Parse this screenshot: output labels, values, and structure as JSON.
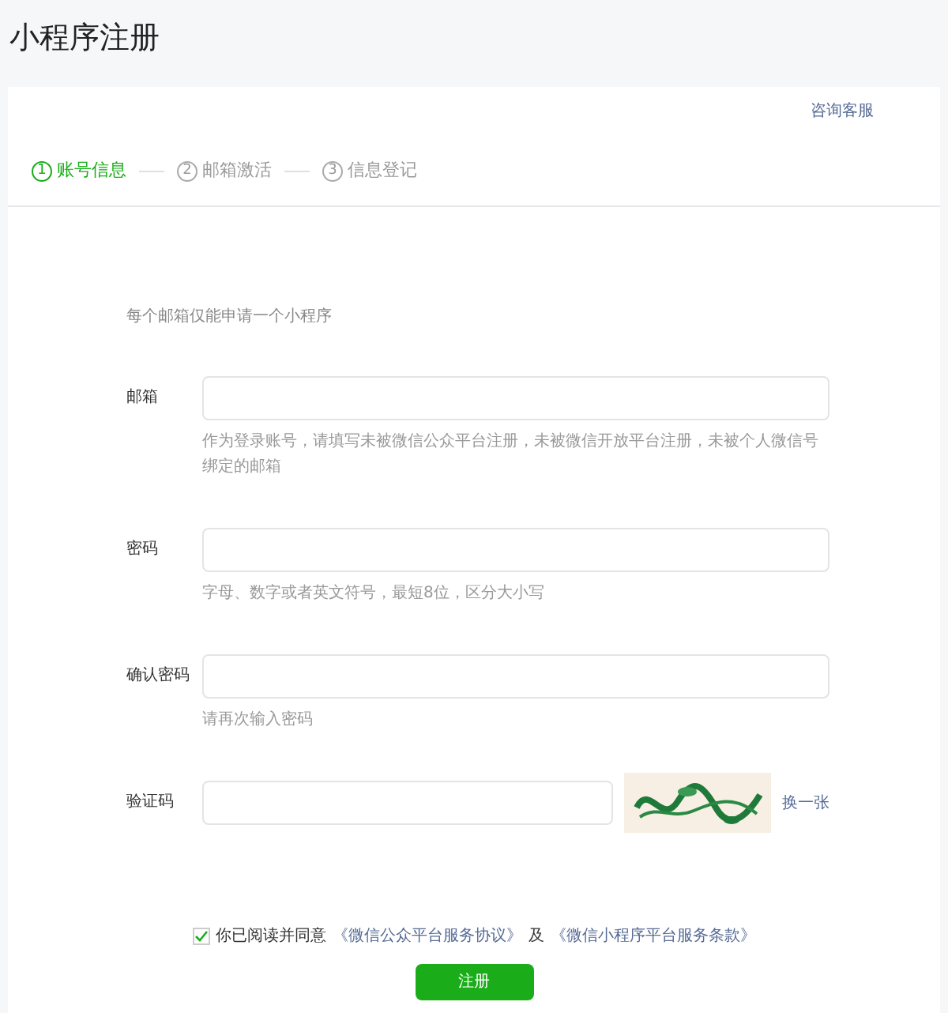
{
  "page_title": "小程序注册",
  "support_link": "咨询客服",
  "steps": [
    {
      "number": "1",
      "label": "账号信息",
      "selected": true
    },
    {
      "number": "2",
      "label": "邮箱激活",
      "selected": false
    },
    {
      "number": "3",
      "label": "信息登记",
      "selected": false
    }
  ],
  "intro": "每个邮箱仅能申请一个小程序",
  "fields": [
    {
      "kind": "input",
      "label": "邮箱",
      "hint": "作为登录账号，请填写未被微信公众平台注册，未被微信开放平台注册，未被个人微信号绑定的邮箱"
    },
    {
      "kind": "input",
      "label": "密码",
      "hint": "字母、数字或者英文符号，最短8位，区分大小写"
    },
    {
      "kind": "input",
      "label": "确认密码",
      "hint": "请再次输入密码"
    },
    {
      "kind": "captcha",
      "label": "验证码",
      "refresh_link": "换一张"
    }
  ],
  "agreement": {
    "checked": true,
    "text": "你已阅读并同意",
    "link_1": "《微信公众平台服务协议》",
    "joiner": "及",
    "link_2": "《微信小程序平台服务条款》"
  },
  "submit_button": "注册"
}
